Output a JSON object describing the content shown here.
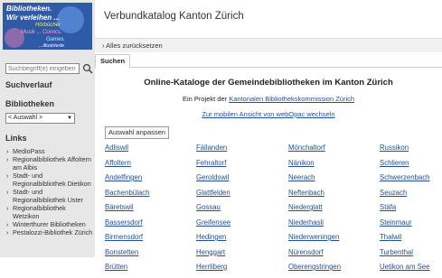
{
  "logo": {
    "line1": "Bibliotheken.",
    "line2": "Wir verleihen ...",
    "line3": "Hörbücher",
    "line4": "Musik ... Comics.",
    "line5": "Games.",
    "line6": "...illustrierte"
  },
  "header": {
    "title": "Verbundkatalog Kanton Zürich"
  },
  "toolbar": {
    "reset_label": "Alles zurücksetzen"
  },
  "tabs": [
    {
      "label": "Suchen"
    }
  ],
  "sidebar": {
    "search": {
      "placeholder": "Suchbegriff(e) eingeben"
    },
    "history_heading": "Suchverlauf",
    "libraries_heading": "Bibliotheken",
    "libraries_select_value": "< Auswahl >",
    "links_heading": "Links",
    "links": [
      "MedioPass",
      "Regionalbibliothek Affoltern am Albis",
      "Stadt- und Regionalbibliothek Dietikon",
      "Stadt- und Regionalbibliothek Uster",
      "Regionalbibliothek Wetzikon",
      "Winterthurer Bibliotheken",
      "Pestalozzi-Bibliothek Zürich"
    ]
  },
  "main": {
    "heading": "Online-Kataloge der Gemeindebibliotheken im Kanton Zürich",
    "project_prefix": "Ein Projekt der ",
    "project_link": "Kantonalen Bibliothekskommission Zürich",
    "mobile_link": "Zur mobilen Ansicht von webOpac wechseln",
    "adjust_button": "Auswahl anpassen",
    "library_columns": [
      [
        "Adliswil",
        "Affoltern",
        "Andelfingen",
        "Bachenbülach",
        "Bäretswil",
        "Bassersdorf",
        "Birmensdorf",
        "Bonstetten",
        "Brütten"
      ],
      [
        "Fällanden",
        "Fehraltorf",
        "Geroldswil",
        "Glattfelden",
        "Gossau",
        "Greifensee",
        "Hedingen",
        "Henggart",
        "Herrliberg"
      ],
      [
        "Mönchaltorf",
        "Nänikon",
        "Neerach",
        "Neftenbach",
        "Niederglatt",
        "Niederhasli",
        "Niederweningen",
        "Nürensdorf",
        "Oberengstringen"
      ],
      [
        "Russikon",
        "Schlieren",
        "Schwerzenbach",
        "Seuzach",
        "Stäfa",
        "Steinmaur",
        "Thalwil",
        "Turbenthal",
        "Uetikon am See"
      ]
    ]
  },
  "colors": {
    "link": "#1f4e9c",
    "sidebar_bg": "#e7e7e7",
    "logo_bg": "#2f5aa8"
  },
  "icons": {
    "search": "search-icon",
    "chevron": "chevron-right-icon"
  }
}
